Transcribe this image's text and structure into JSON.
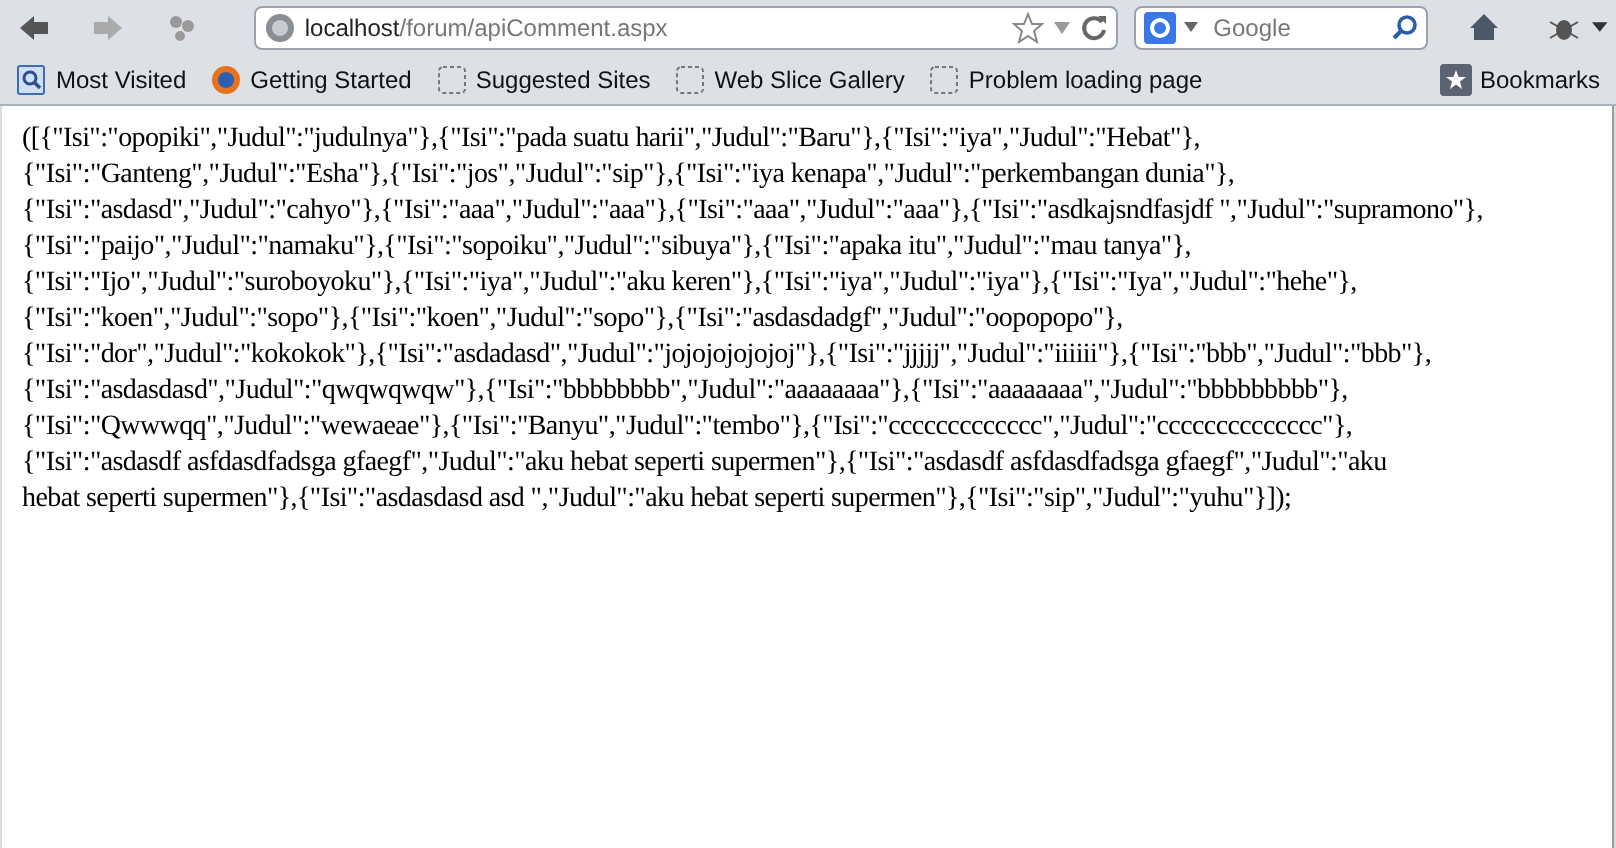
{
  "toolbar": {
    "url_host": "localhost",
    "url_path": "/forum/apiComment.aspx",
    "search_placeholder": "Google"
  },
  "bookmarks": [
    {
      "label": "Most Visited",
      "kind": "folder"
    },
    {
      "label": "Getting Started",
      "kind": "globe"
    },
    {
      "label": "Suggested Sites",
      "kind": "blank"
    },
    {
      "label": "Web Slice Gallery",
      "kind": "blank"
    },
    {
      "label": "Problem loading page",
      "kind": "blank"
    }
  ],
  "bookmarks_menu": "Bookmarks",
  "content_lines": [
    "([{\"Isi\":\"opopiki\",\"Judul\":\"judulnya\"},{\"Isi\":\"pada suatu harii\",\"Judul\":\"Baru\"},{\"Isi\":\"iya\",\"Judul\":\"Hebat\"},",
    "{\"Isi\":\"Ganteng\",\"Judul\":\"Esha\"},{\"Isi\":\"jos\",\"Judul\":\"sip\"},{\"Isi\":\"iya kenapa\",\"Judul\":\"perkembangan dunia\"},",
    "{\"Isi\":\"asdasd\",\"Judul\":\"cahyo\"},{\"Isi\":\"aaa\",\"Judul\":\"aaa\"},{\"Isi\":\"aaa\",\"Judul\":\"aaa\"},{\"Isi\":\"asdkajsndfasjdf \",\"Judul\":\"supramono\"},",
    "{\"Isi\":\"paijo\",\"Judul\":\"namaku\"},{\"Isi\":\"sopoiku\",\"Judul\":\"sibuya\"},{\"Isi\":\"apaka itu\",\"Judul\":\"mau tanya\"},",
    "{\"Isi\":\"Ijo\",\"Judul\":\"suroboyoku\"},{\"Isi\":\"iya\",\"Judul\":\"aku keren\"},{\"Isi\":\"iya\",\"Judul\":\"iya\"},{\"Isi\":\"Iya\",\"Judul\":\"hehe\"},",
    "{\"Isi\":\"koen\",\"Judul\":\"sopo\"},{\"Isi\":\"koen\",\"Judul\":\"sopo\"},{\"Isi\":\"asdasdadgf\",\"Judul\":\"oopopopo\"},",
    "{\"Isi\":\"dor\",\"Judul\":\"kokokok\"},{\"Isi\":\"asdadasd\",\"Judul\":\"jojojojojojoj\"},{\"Isi\":\"jjjjj\",\"Judul\":\"iiiiii\"},{\"Isi\":\"bbb\",\"Judul\":\"bbb\"},",
    "{\"Isi\":\"asdasdasd\",\"Judul\":\"qwqwqwqw\"},{\"Isi\":\"bbbbbbbb\",\"Judul\":\"aaaaaaaa\"},{\"Isi\":\"aaaaaaaa\",\"Judul\":\"bbbbbbbbb\"},",
    "{\"Isi\":\"Qwwwqq\",\"Judul\":\"wewaeae\"},{\"Isi\":\"Banyu\",\"Judul\":\"tembo\"},{\"Isi\":\"ccccccccccccc\",\"Judul\":\"cccccccccccccc\"},",
    "{\"Isi\":\"asdasdf asfdasdfadsga gfaegf\",\"Judul\":\"aku hebat seperti supermen\"},{\"Isi\":\"asdasdf asfdasdfadsga gfaegf\",\"Judul\":\"aku",
    "hebat seperti supermen\"},{\"Isi\":\"asdasdasd asd \",\"Judul\":\"aku hebat seperti supermen\"},{\"Isi\":\"sip\",\"Judul\":\"yuhu\"}]);"
  ]
}
